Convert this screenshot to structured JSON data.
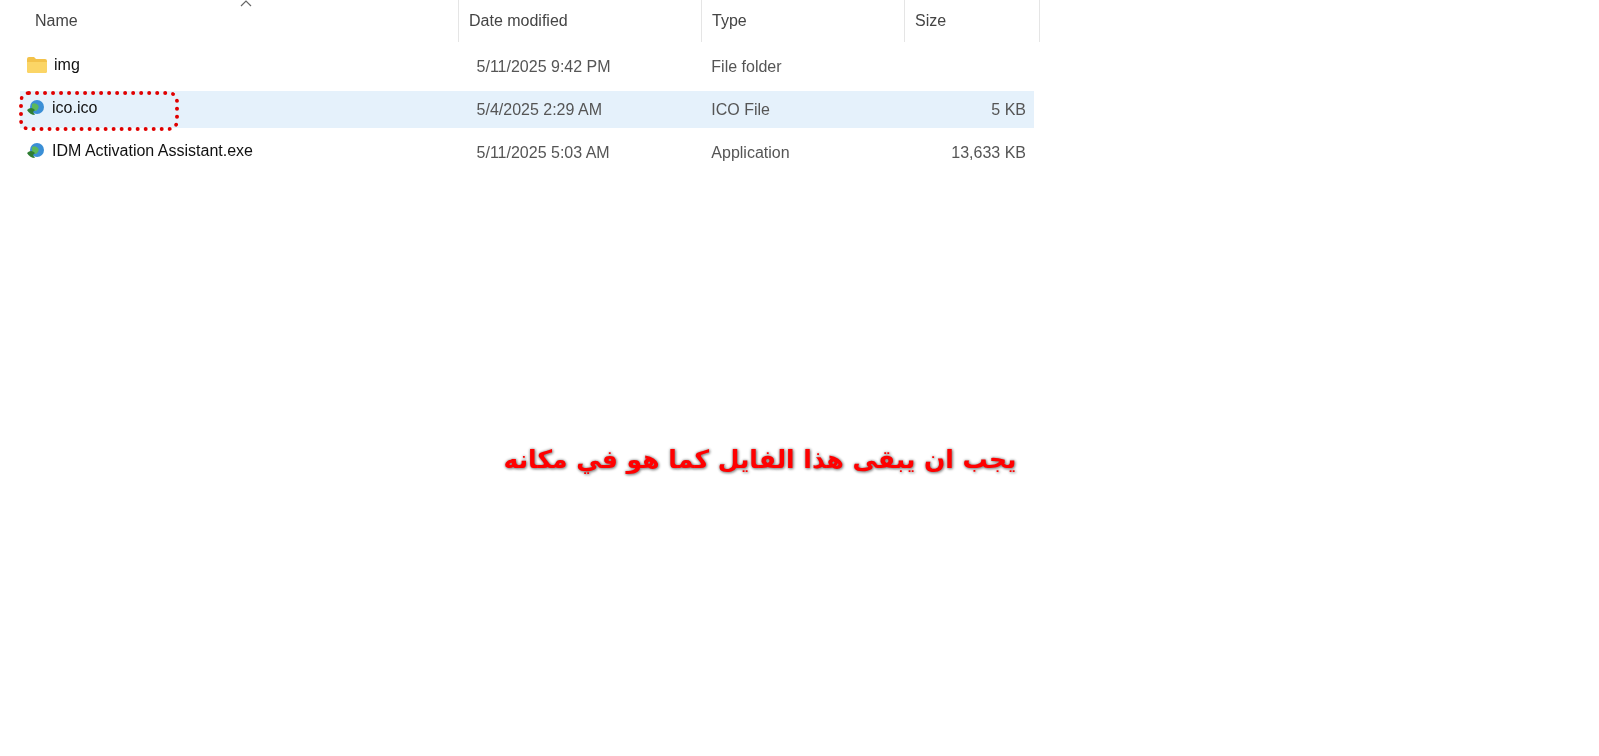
{
  "columns": [
    {
      "label": "Name",
      "sorted": true
    },
    {
      "label": "Date modified",
      "sorted": false
    },
    {
      "label": "Type",
      "sorted": false
    },
    {
      "label": "Size",
      "sorted": false
    }
  ],
  "rows": [
    {
      "kind": "folder",
      "name": "img",
      "date": "5/11/2025 9:42 PM",
      "type": "File folder",
      "size": "",
      "selected": false,
      "circled": false
    },
    {
      "kind": "app",
      "name": "ico.ico",
      "date": "5/4/2025 2:29 AM",
      "type": "ICO File",
      "size": "5 KB",
      "selected": true,
      "circled": true
    },
    {
      "kind": "app",
      "name": "IDM Activation Assistant.exe",
      "date": "5/11/2025 5:03 AM",
      "type": "Application",
      "size": "13,633 KB",
      "selected": false,
      "circled": false
    }
  ],
  "caption": "يجب ان يبقى هذا الفايل كما  هو في مكانه"
}
